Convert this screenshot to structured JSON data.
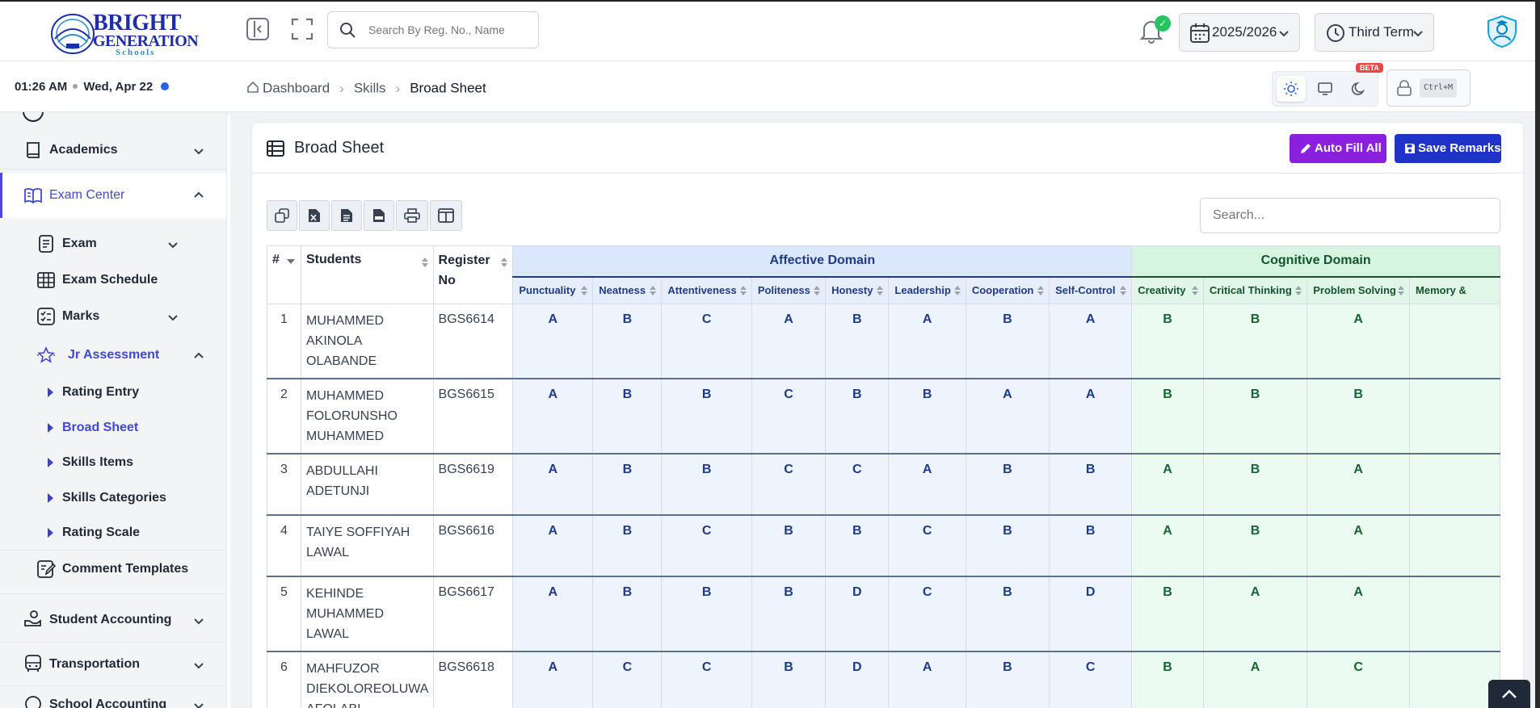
{
  "header": {
    "logo": {
      "line1": "BRIGHT",
      "line2": "GENERATION",
      "line3": "Schools"
    },
    "search_placeholder": "Search By Reg. No., Name",
    "notification_badge": "✓",
    "session": "2025/2026",
    "term": "Third Term"
  },
  "subheader": {
    "time": "01:26 AM",
    "date": "Wed, Apr 22",
    "breadcrumbs": [
      "Dashboard",
      "Skills",
      "Broad Sheet"
    ],
    "beta_label": "BETA",
    "lock_shortcut": "Ctrl+M"
  },
  "sidebar": {
    "items": [
      {
        "label": "Academics"
      },
      {
        "label": "Exam Center"
      },
      {
        "label": "Exam"
      },
      {
        "label": "Exam Schedule"
      },
      {
        "label": "Marks"
      },
      {
        "label": "Jr Assessment"
      },
      {
        "label": "Rating Entry"
      },
      {
        "label": "Broad Sheet"
      },
      {
        "label": "Skills Items"
      },
      {
        "label": "Skills Categories"
      },
      {
        "label": "Rating Scale"
      },
      {
        "label": "Comment Templates"
      },
      {
        "label": "Student Accounting"
      },
      {
        "label": "Transportation"
      },
      {
        "label": "School Accounting"
      }
    ]
  },
  "card": {
    "title": "Broad Sheet",
    "auto_fill_label": "Auto Fill All",
    "save_label": "Save Remarks",
    "table_search_placeholder": "Search..."
  },
  "table": {
    "col_index": "#",
    "col_students": "Students",
    "col_register": "Register No",
    "group_affective": "Affective Domain",
    "group_cognitive": "Cognitive Domain",
    "affective": [
      "Punctuality",
      "Neatness",
      "Attentiveness",
      "Politeness",
      "Honesty",
      "Leadership",
      "Cooperation",
      "Self-Control"
    ],
    "cognitive": [
      "Creativity",
      "Critical Thinking",
      "Problem Solving",
      "Memory &"
    ],
    "rows": [
      {
        "n": "1",
        "name": "MUHAMMED AKINOLA OLABANDE",
        "reg": "BGS6614",
        "aff": [
          "A",
          "B",
          "C",
          "A",
          "B",
          "A",
          "B",
          "A"
        ],
        "cog": [
          "B",
          "B",
          "A",
          ""
        ]
      },
      {
        "n": "2",
        "name": "MUHAMMED FOLORUNSHO MUHAMMED",
        "reg": "BGS6615",
        "aff": [
          "A",
          "B",
          "B",
          "C",
          "B",
          "B",
          "A",
          "A"
        ],
        "cog": [
          "B",
          "B",
          "B",
          ""
        ]
      },
      {
        "n": "3",
        "name": "ABDULLAHI ADETUNJI",
        "reg": "BGS6619",
        "aff": [
          "A",
          "B",
          "B",
          "C",
          "C",
          "A",
          "B",
          "B"
        ],
        "cog": [
          "A",
          "B",
          "A",
          ""
        ]
      },
      {
        "n": "4",
        "name": "TAIYE SOFFIYAH LAWAL",
        "reg": "BGS6616",
        "aff": [
          "A",
          "B",
          "C",
          "B",
          "B",
          "C",
          "B",
          "B"
        ],
        "cog": [
          "A",
          "B",
          "A",
          ""
        ]
      },
      {
        "n": "5",
        "name": "KEHINDE MUHAMMED LAWAL",
        "reg": "BGS6617",
        "aff": [
          "A",
          "B",
          "B",
          "B",
          "D",
          "C",
          "B",
          "D"
        ],
        "cog": [
          "B",
          "A",
          "A",
          ""
        ]
      },
      {
        "n": "6",
        "name": "MAHFUZOR DIEKOLOREOLUWA AFOLABI",
        "reg": "BGS6618",
        "aff": [
          "A",
          "C",
          "C",
          "B",
          "D",
          "A",
          "B",
          "C"
        ],
        "cog": [
          "B",
          "A",
          "C",
          ""
        ]
      }
    ]
  }
}
